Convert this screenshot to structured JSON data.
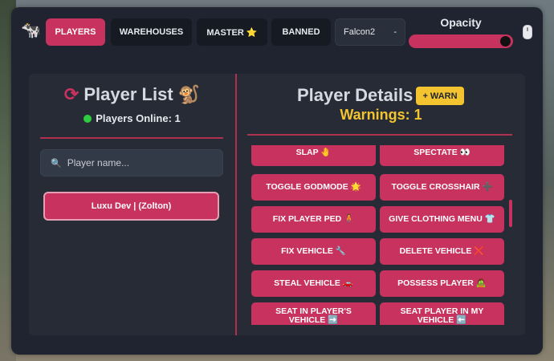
{
  "logo_icon": "cow-emoji",
  "tabs": [
    {
      "label": "PLAYERS",
      "active": true
    },
    {
      "label": "WAREHOUSES",
      "active": false
    },
    {
      "label": "MASTER ⭐",
      "active": false
    },
    {
      "label": "BANNED",
      "active": false
    }
  ],
  "dropdown": {
    "value": "Falcon2",
    "arrow": "-"
  },
  "opacity": {
    "label": "Opacity",
    "value_fraction": 1.0
  },
  "player_list": {
    "title": "Player List",
    "title_emoji": "🐒",
    "online_label": "Players Online: 1",
    "search_placeholder": "Player name...",
    "players": [
      "Luxu Dev | (Zolton)"
    ]
  },
  "player_details": {
    "title": "Player Details",
    "warn_label": "+ WARN",
    "warnings_label": "Warnings:",
    "warnings_count": "1",
    "actions": [
      "SLAP 🤚",
      "SPECTATE 👀",
      "TOGGLE GODMODE 🌟",
      "TOGGLE CROSSHAIR ➕",
      "FIX PLAYER PED 🧍",
      "GIVE CLOTHING MENU 👕",
      "FIX VEHICLE 🔧",
      "DELETE VEHICLE ❌",
      "STEAL VEHICLE 🚗",
      "POSSESS PLAYER 🧟",
      "SEAT IN PLAYER'S VEHICLE ➡️",
      "SEAT PLAYER IN MY VEHICLE ⬅️"
    ]
  },
  "colors": {
    "accent": "#c8325e",
    "warn": "#f4c430",
    "panel": "#262b36",
    "window": "#1f2430"
  }
}
